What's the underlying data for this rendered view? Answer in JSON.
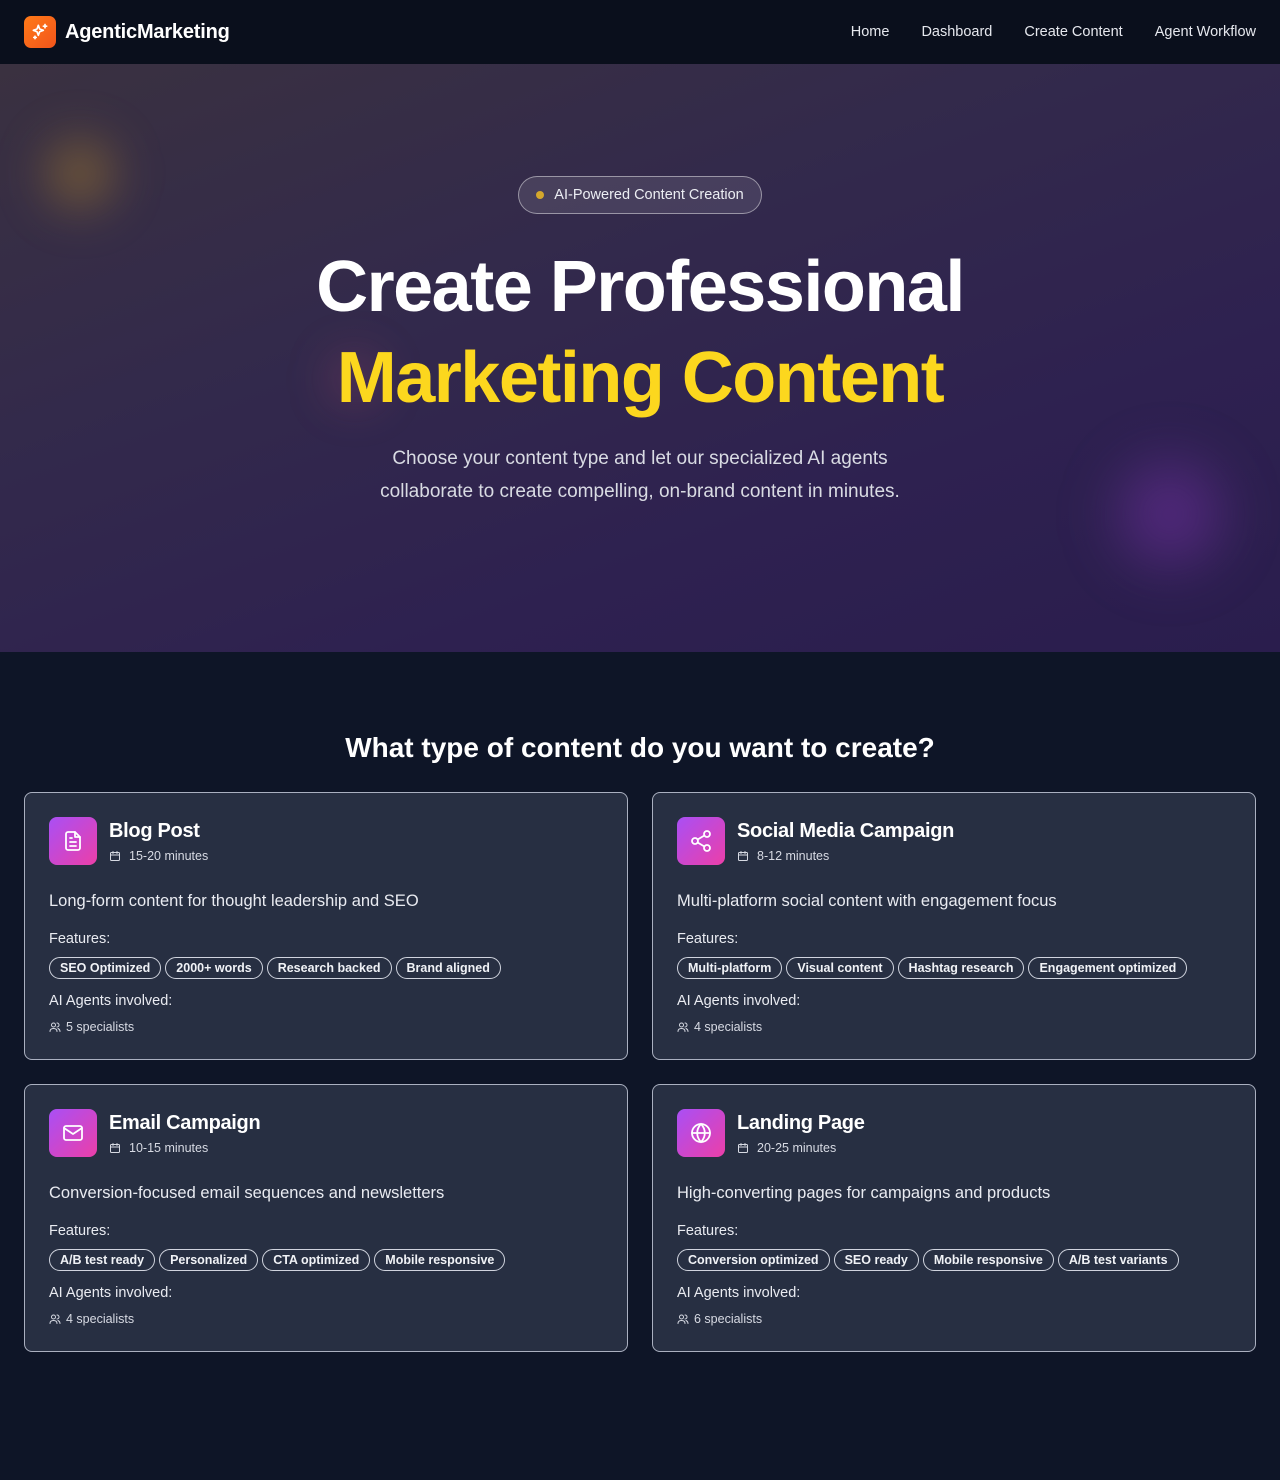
{
  "nav": {
    "brand": "AgenticMarketing",
    "links": [
      "Home",
      "Dashboard",
      "Create Content",
      "Agent Workflow"
    ]
  },
  "hero": {
    "badge": "AI-Powered Content Creation",
    "title_line1": "Create Professional",
    "title_line2": "Marketing Content",
    "subtitle": "Choose your content type and let our specialized AI agents collaborate to create compelling, on-brand content in minutes."
  },
  "section": {
    "title": "What type of content do you want to create?"
  },
  "labels": {
    "features": "Features:",
    "agents": "AI Agents involved:"
  },
  "cards": [
    {
      "title": "Blog Post",
      "icon": "document-icon",
      "time": "15-20 minutes",
      "description": "Long-form content for thought leadership and SEO",
      "features": [
        "SEO Optimized",
        "2000+ words",
        "Research backed",
        "Brand aligned"
      ],
      "agents": "5 specialists"
    },
    {
      "title": "Social Media Campaign",
      "icon": "share-icon",
      "time": "8-12 minutes",
      "description": "Multi-platform social content with engagement focus",
      "features": [
        "Multi-platform",
        "Visual content",
        "Hashtag research",
        "Engagement optimized"
      ],
      "agents": "4 specialists"
    },
    {
      "title": "Email Campaign",
      "icon": "mail-icon",
      "time": "10-15 minutes",
      "description": "Conversion-focused email sequences and newsletters",
      "features": [
        "A/B test ready",
        "Personalized",
        "CTA optimized",
        "Mobile responsive"
      ],
      "agents": "4 specialists"
    },
    {
      "title": "Landing Page",
      "icon": "globe-icon",
      "time": "20-25 minutes",
      "description": "High-converting pages for campaigns and products",
      "features": [
        "Conversion optimized",
        "SEO ready",
        "Mobile responsive",
        "A/B test variants"
      ],
      "agents": "6 specialists"
    }
  ],
  "colors": {
    "accent_yellow": "#fcd71e",
    "brand_orange": "#ff7a18",
    "icon_gradient_start": "#a94ff5",
    "icon_gradient_end": "#ec3fa8",
    "card_bg": "#272f42",
    "page_bg": "#0e1527"
  }
}
